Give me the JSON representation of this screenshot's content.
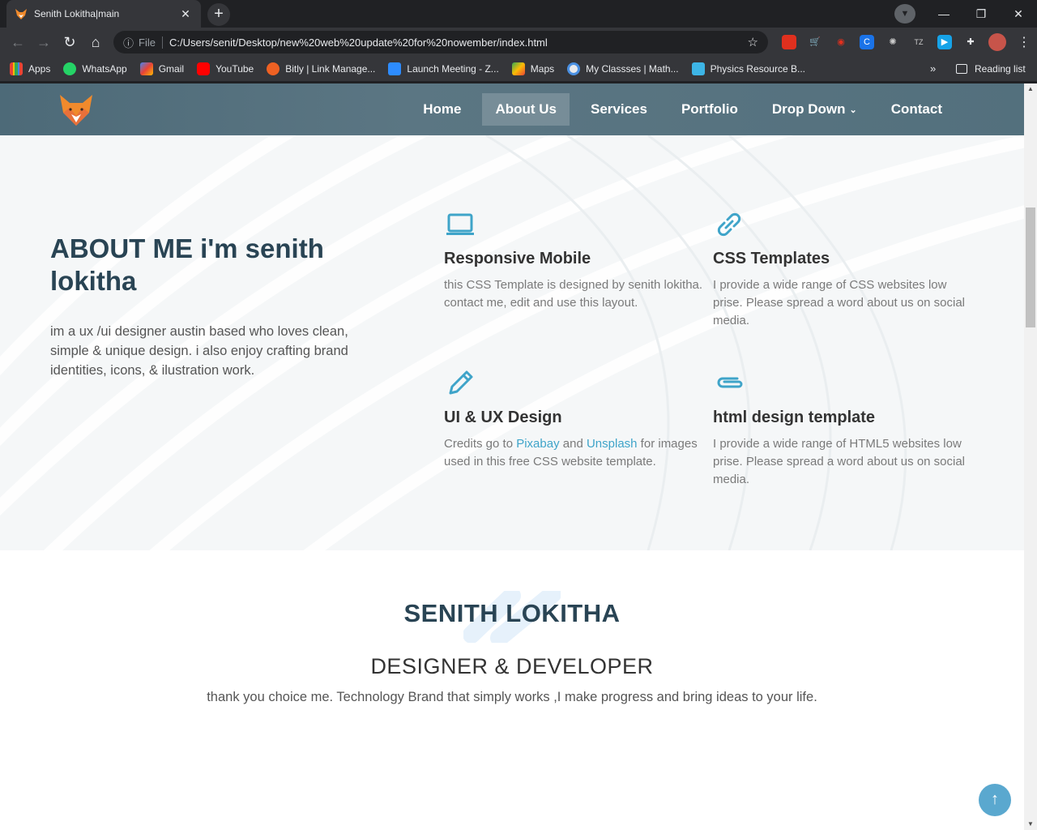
{
  "browser": {
    "tab_title": "Senith Lokitha|main",
    "address_prefix": "File",
    "url": "C:/Users/senit/Desktop/new%20web%20update%20for%20nowember/index.html",
    "bookmarks": [
      {
        "label": "Apps",
        "icon": "apps-grid-icon",
        "color": "#ea4335"
      },
      {
        "label": "WhatsApp",
        "icon": "whatsapp-icon",
        "color": "#25d366"
      },
      {
        "label": "Gmail",
        "icon": "gmail-icon",
        "color": "#ea4335"
      },
      {
        "label": "YouTube",
        "icon": "youtube-icon",
        "color": "#ff0000"
      },
      {
        "label": "Bitly | Link Manage...",
        "icon": "bitly-icon",
        "color": "#ee6123"
      },
      {
        "label": "Launch Meeting - Z...",
        "icon": "zoom-icon",
        "color": "#2d8cff"
      },
      {
        "label": "Maps",
        "icon": "maps-icon",
        "color": "#34a853"
      },
      {
        "label": "My Classses | Math...",
        "icon": "math-icon",
        "color": "#4a90e2"
      },
      {
        "label": "Physics Resource B...",
        "icon": "physics-icon",
        "color": "#3db5e6"
      }
    ],
    "reading_list": "Reading list",
    "more": "»"
  },
  "site": {
    "nav": [
      {
        "label": "Home",
        "active": false
      },
      {
        "label": "About Us",
        "active": true
      },
      {
        "label": "Services",
        "active": false
      },
      {
        "label": "Portfolio",
        "active": false
      },
      {
        "label": "Drop Down",
        "active": false,
        "dropdown": true
      },
      {
        "label": "Contact",
        "active": false
      }
    ],
    "about": {
      "heading": "ABOUT ME i'm senith lokitha",
      "text": "im a ux /ui designer austin based who loves clean, simple & unique design. i also enjoy crafting brand identities, icons, & ilustration work.",
      "features": [
        {
          "icon": "laptop-icon",
          "title": "Responsive Mobile",
          "text": "this CSS Template is designed by senith lokitha. contact me, edit and use this layout."
        },
        {
          "icon": "link-icon",
          "title": "CSS Templates",
          "text": "I provide a wide range of CSS websites low prise. Please spread a word about us on social media."
        },
        {
          "icon": "pencil-icon",
          "title": "UI & UX Design",
          "text_before": "Credits go to ",
          "link1": "Pixabay",
          "text_mid": " and ",
          "link2": "Unsplash",
          "text_after": " for images used in this free CSS website template."
        },
        {
          "icon": "paperclip-icon",
          "title": "html design template",
          "text": "I provide a wide range of HTML5 websites low prise. Please spread a word about us on social media."
        }
      ]
    },
    "hero": {
      "name": "SENITH LOKITHA",
      "role": "DESIGNER & DEVELOPER",
      "tagline": "thank you choice me. Technology Brand that simply works ,I make progress and bring ideas to your life."
    },
    "accent": "#3fa4c9",
    "heading_color": "#294454"
  }
}
